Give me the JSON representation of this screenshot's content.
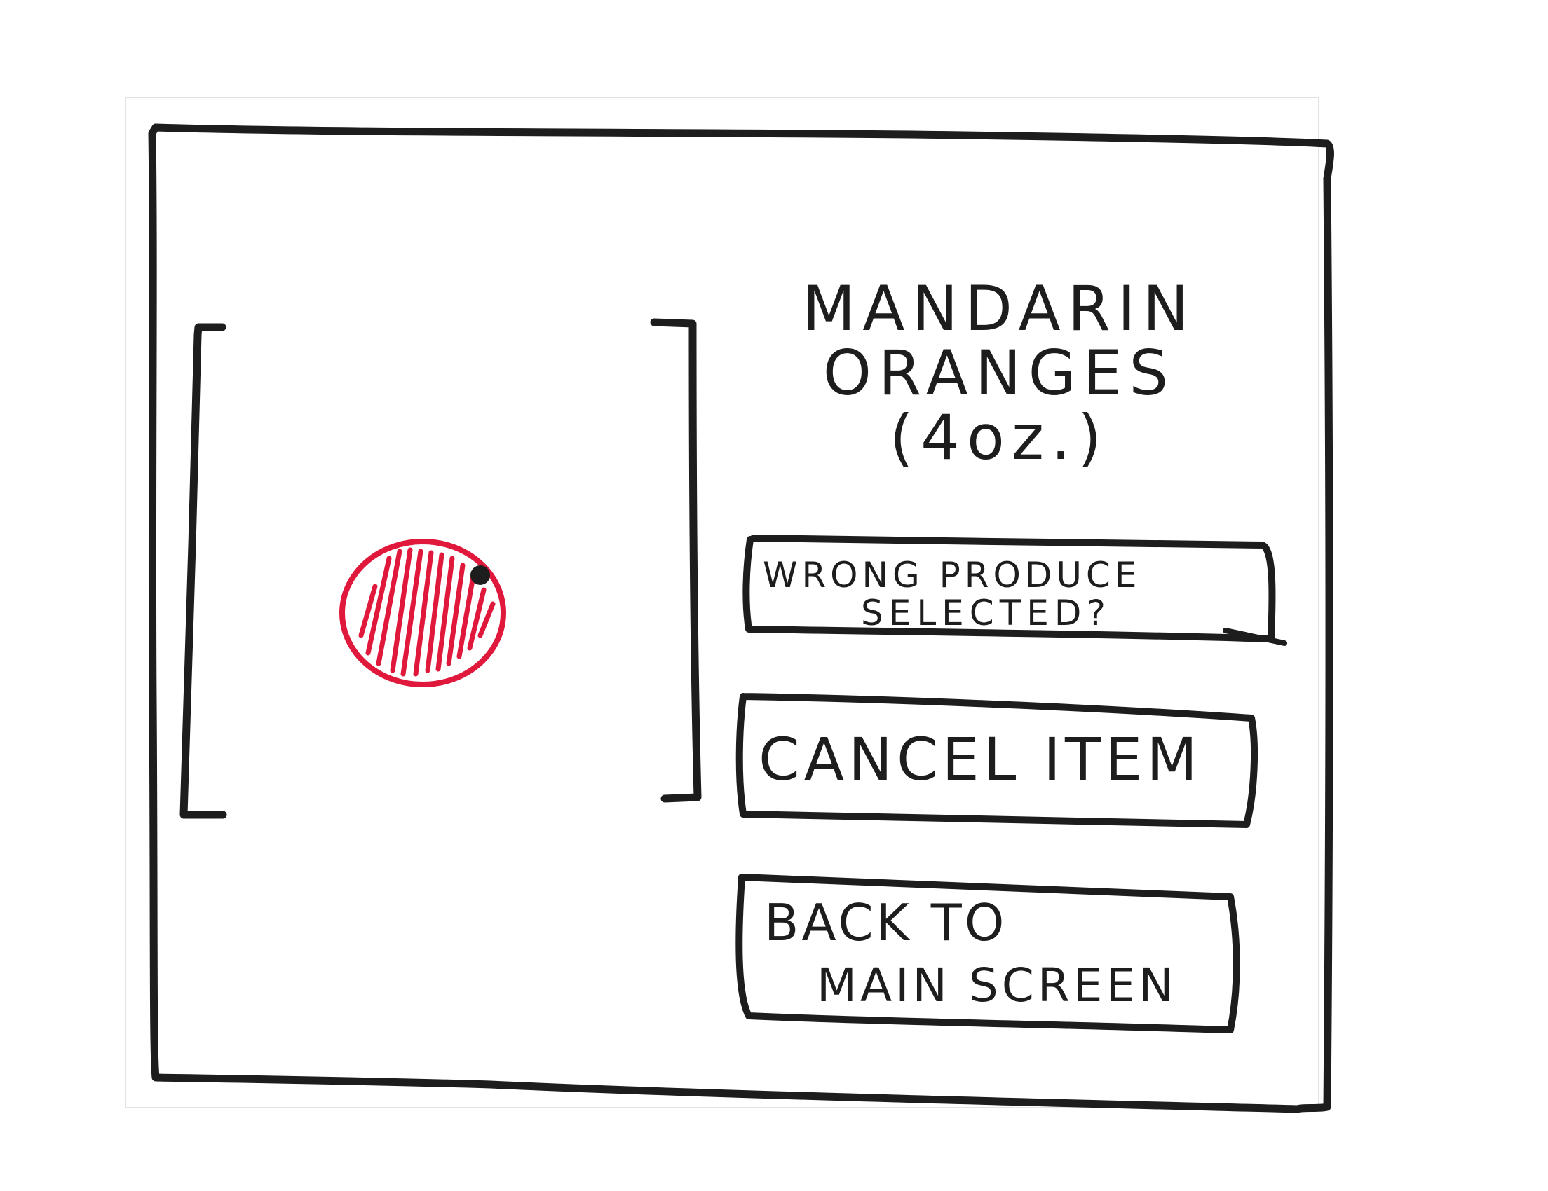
{
  "product": {
    "name_line1": "MANDARIN",
    "name_line2": "ORANGES",
    "size": "(4oz.)",
    "image_icon": "mandarin-orange-icon"
  },
  "actions": {
    "wrong_produce_line1": "WRONG PRODUCE",
    "wrong_produce_line2": "SELECTED?",
    "cancel_item": "CANCEL ITEM",
    "back_line1": "BACK TO",
    "back_line2": "MAIN SCREEN"
  },
  "colors": {
    "ink": "#1d1d1d",
    "fruit": "#e0183c",
    "background": "#ffffff"
  }
}
